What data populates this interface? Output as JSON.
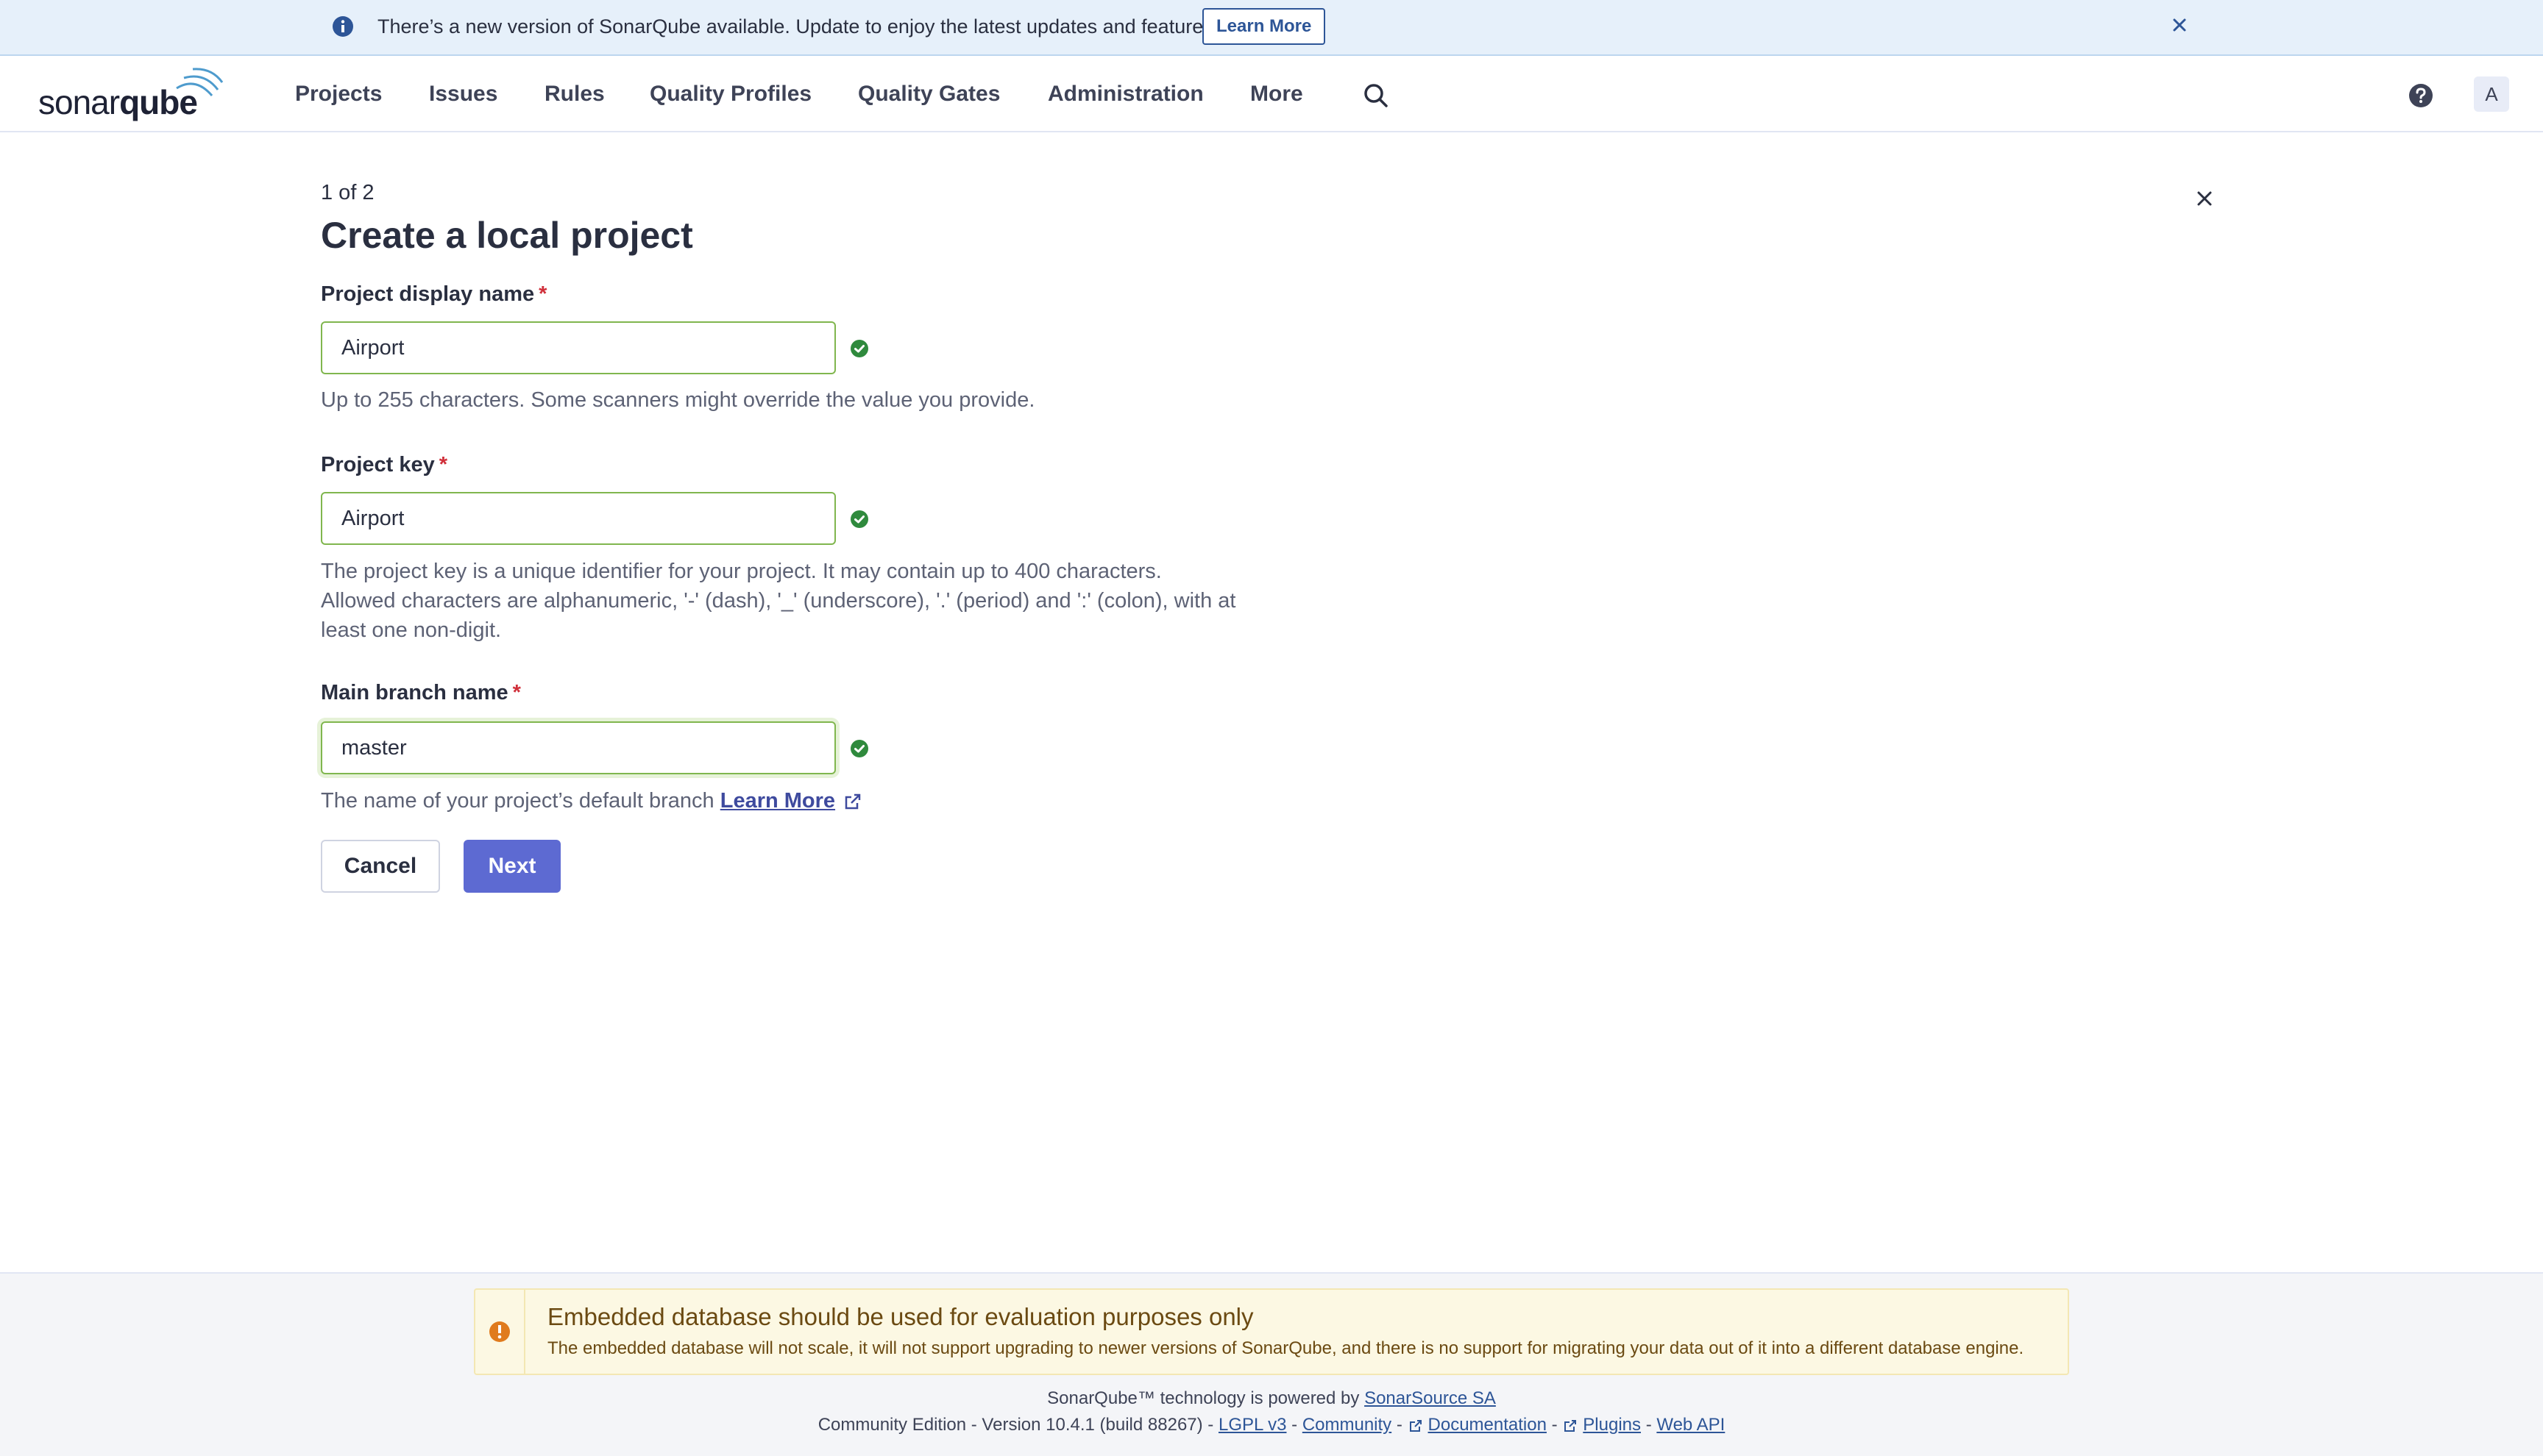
{
  "banner": {
    "message": "There’s a new version of SonarQube available. Update to enjoy the latest updates and features.",
    "learn_more": "Learn More",
    "info_icon": "info-icon",
    "close_icon": "close-icon"
  },
  "nav": {
    "logo_light": "sonar",
    "logo_bold": "qube",
    "items": [
      "Projects",
      "Issues",
      "Rules",
      "Quality Profiles",
      "Quality Gates",
      "Administration",
      "More"
    ],
    "search_icon": "search-icon",
    "help_icon": "help-icon",
    "avatar": "A"
  },
  "form": {
    "step": "1 of 2",
    "title": "Create a local project",
    "display_name": {
      "label": "Project display name",
      "required": "*",
      "value": "Airport",
      "help": "Up to 255 characters. Some scanners might override the value you provide."
    },
    "project_key": {
      "label": "Project key",
      "required": "*",
      "value": "Airport",
      "help_lines": [
        "The project key is a unique identifier for your project. It may contain up to 400 characters.",
        "Allowed characters are alphanumeric, '-' (dash), '_' (underscore), '.' (period) and ':' (colon), with at",
        "least one non-digit."
      ]
    },
    "main_branch": {
      "label": "Main branch name",
      "required": "*",
      "value": "master",
      "help": "The name of your project’s default branch",
      "help_link": "Learn More"
    },
    "cancel": "Cancel",
    "next": "Next"
  },
  "footer": {
    "warning_title": "Embedded database should be used for evaluation purposes only",
    "warning_body": "The embedded database will not scale, it will not support upgrading to newer versions of SonarQube, and there is no support for migrating your data out of it into a different database engine.",
    "powered_by": "SonarQube™ technology is powered by",
    "powered_link": "SonarSource SA",
    "edition": "Community Edition - Version 10.4.1 (build 88267) -",
    "sep": "-",
    "links": [
      "LGPL v3",
      "Community",
      "Documentation",
      "Plugins",
      "Web API"
    ]
  },
  "colors": {
    "primary": "#5d6ad2",
    "valid": "#80b64e",
    "banner_bg": "#e6f0fa",
    "warning_bg": "#fcf8e3"
  }
}
